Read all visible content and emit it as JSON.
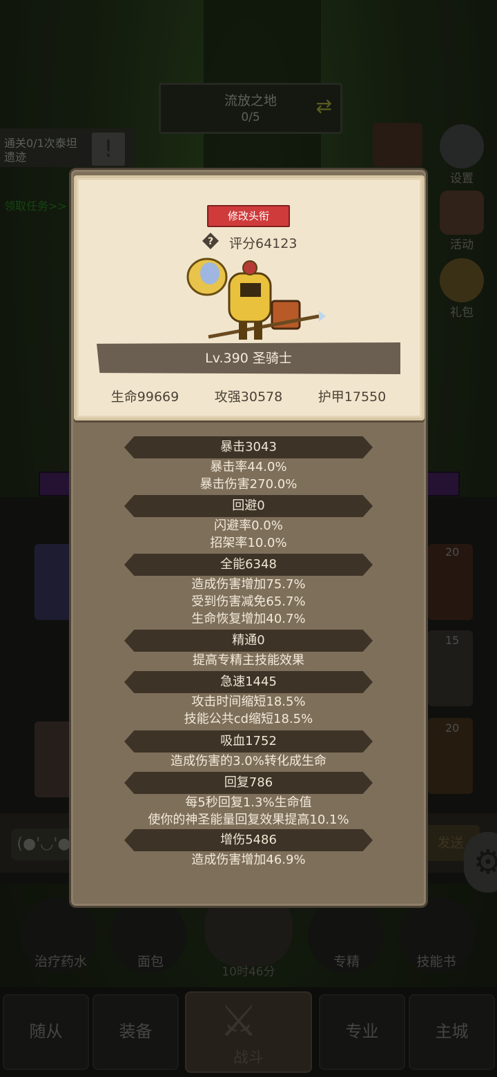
{
  "top": {
    "stage_name": "流放之地",
    "stage_progress": "0/5",
    "quest_text": "通关0/1次泰坦遗迹",
    "quest_link": "领取任务>>"
  },
  "side_buttons": [
    {
      "label": "设置",
      "icon": "gear-icon"
    },
    {
      "label": "活动",
      "icon": "scroll-icon"
    },
    {
      "label": "礼包",
      "icon": "gift-icon"
    }
  ],
  "card_badges": [
    "20",
    "15",
    "20"
  ],
  "character": {
    "rename_label": "修改头衔",
    "score": "评分64123",
    "level_class": "Lv.390 圣骑士",
    "hp": "生命99669",
    "attack": "攻强30578",
    "armor": "护甲17550"
  },
  "stats": [
    {
      "header": "暴击3043",
      "lines": [
        "暴击率44.0%",
        "暴击伤害270.0%"
      ]
    },
    {
      "header": "回避0",
      "lines": [
        "闪避率0.0%",
        "招架率10.0%"
      ]
    },
    {
      "header": "全能6348",
      "lines": [
        "造成伤害增加75.7%",
        "受到伤害减免65.7%",
        "生命恢复增加40.7%"
      ]
    },
    {
      "header": "精通0",
      "lines": [
        "提高专精主技能效果"
      ]
    },
    {
      "header": "急速1445",
      "lines": [
        "攻击时间缩短18.5%",
        "技能公共cd缩短18.5%"
      ]
    },
    {
      "header": "吸血1752",
      "lines": [
        "造成伤害的3.0%转化成生命"
      ]
    },
    {
      "header": "回复786",
      "lines": [
        "每5秒回复1.3%生命值",
        "使你的神圣能量回复效果提高10.1%"
      ]
    },
    {
      "header": "增伤5486",
      "lines": [
        "造成伤害增加46.9%"
      ]
    }
  ],
  "chat": {
    "emote": "(●'◡'●",
    "send": "发送"
  },
  "consumables": [
    {
      "label": "治疗药水"
    },
    {
      "label": "面包"
    },
    {
      "label": "专精"
    },
    {
      "label": "技能书"
    }
  ],
  "timer": "10时46分",
  "nav": {
    "followers": "随从",
    "equipment": "装备",
    "battle": "战斗",
    "profession": "专业",
    "main_city": "主城"
  }
}
